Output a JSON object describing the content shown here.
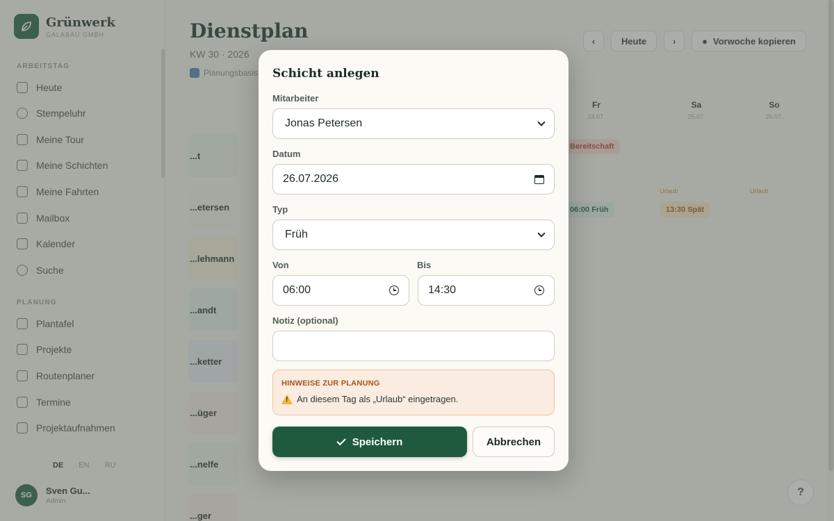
{
  "brand": {
    "name": "Grünwerk",
    "sub": "GALABAU GMBH"
  },
  "sidebar": {
    "sections": [
      {
        "title": "ARBEITSTAG",
        "items": [
          "Heute",
          "Stempeluhr",
          "Meine Tour",
          "Meine Schichten",
          "Meine Fahrten",
          "Mailbox",
          "Kalender",
          "Suche"
        ]
      },
      {
        "title": "PLANUNG",
        "items": [
          "Plantafel",
          "Projekte",
          "Routenplaner",
          "Termine",
          "Projektaufnahmen"
        ]
      }
    ],
    "languages": [
      "DE",
      "EN",
      "RU"
    ],
    "user": {
      "initials": "SG",
      "name": "Sven Gu...",
      "role": "Admin"
    }
  },
  "page": {
    "title": "Dienstplan",
    "subtitle": "KW 30 · 2026",
    "hint": "Planungsbasis",
    "toolbar": {
      "today": "Heute",
      "copy": "Vorwoche kopieren"
    },
    "days": [
      {
        "label": "Fr",
        "date": "24.07."
      },
      {
        "label": "Sa",
        "date": "25.07."
      },
      {
        "label": "So",
        "date": "26.07."
      }
    ],
    "employees": [
      "...t",
      "...etersen",
      "...lehmann",
      "...andt",
      "...ketter",
      "...üger",
      "...nelfe",
      "...ger"
    ],
    "badges": {
      "readiness": "Bereitschaft",
      "shift": "06:00 Früh",
      "warn_shift": "13:30 Spät",
      "flag": "Urlaub"
    }
  },
  "modal": {
    "title": "Schicht anlegen",
    "employee": {
      "label": "Mitarbeiter",
      "value": "Jonas Petersen"
    },
    "date": {
      "label": "Datum",
      "value": "26.07.2026"
    },
    "type": {
      "label": "Typ",
      "value": "Früh"
    },
    "from": {
      "label": "Von",
      "value": "06:00"
    },
    "to": {
      "label": "Bis",
      "value": "14:30"
    },
    "note": {
      "label": "Notiz (optional)",
      "value": ""
    },
    "notice": {
      "title": "HINWEISE ZUR PLANUNG",
      "text": "An diesem Tag als „Urlaub“ eingetragen."
    },
    "save_label": "Speichern",
    "cancel_label": "Abbrechen"
  },
  "help_label": "?"
}
